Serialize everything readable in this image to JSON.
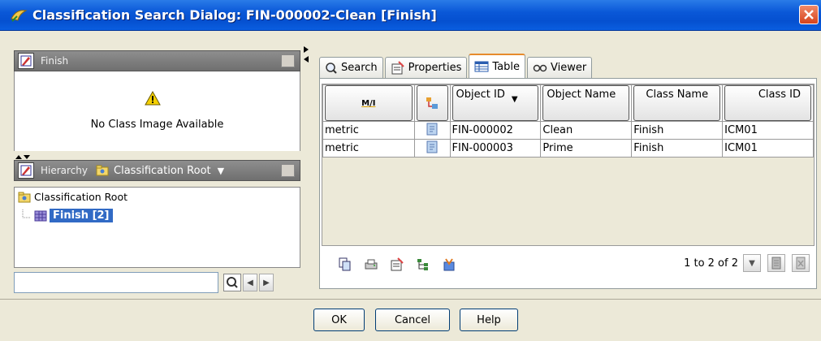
{
  "window": {
    "title": "Classification Search Dialog: FIN-000002-Clean  [Finish]"
  },
  "finish_panel": {
    "title": "Finish",
    "no_image_text": "No Class Image Available"
  },
  "hierarchy_panel": {
    "label": "Hierarchy",
    "root_selector": "Classification Root",
    "tree": {
      "root": "Classification Root",
      "child": "Finish  [2]"
    }
  },
  "tabs": [
    {
      "label": "Search",
      "icon": "search-icon"
    },
    {
      "label": "Properties",
      "icon": "properties-icon"
    },
    {
      "label": "Table",
      "icon": "table-icon",
      "active": true
    },
    {
      "label": "Viewer",
      "icon": "viewer-icon"
    }
  ],
  "table": {
    "columns": [
      "M/I",
      "",
      "Object ID",
      "Object Name",
      "Class Name",
      "Class ID"
    ],
    "rows": [
      {
        "unit": "metric",
        "object_id": "FIN-000002",
        "object_name": "Clean",
        "class_name": "Finish",
        "class_id": "ICM01"
      },
      {
        "unit": "metric",
        "object_id": "FIN-000003",
        "object_name": "Prime",
        "class_name": "Finish",
        "class_id": "ICM01"
      }
    ]
  },
  "pager": {
    "text": "1 to 2 of 2"
  },
  "buttons": {
    "ok": "OK",
    "cancel": "Cancel",
    "help": "Help"
  }
}
